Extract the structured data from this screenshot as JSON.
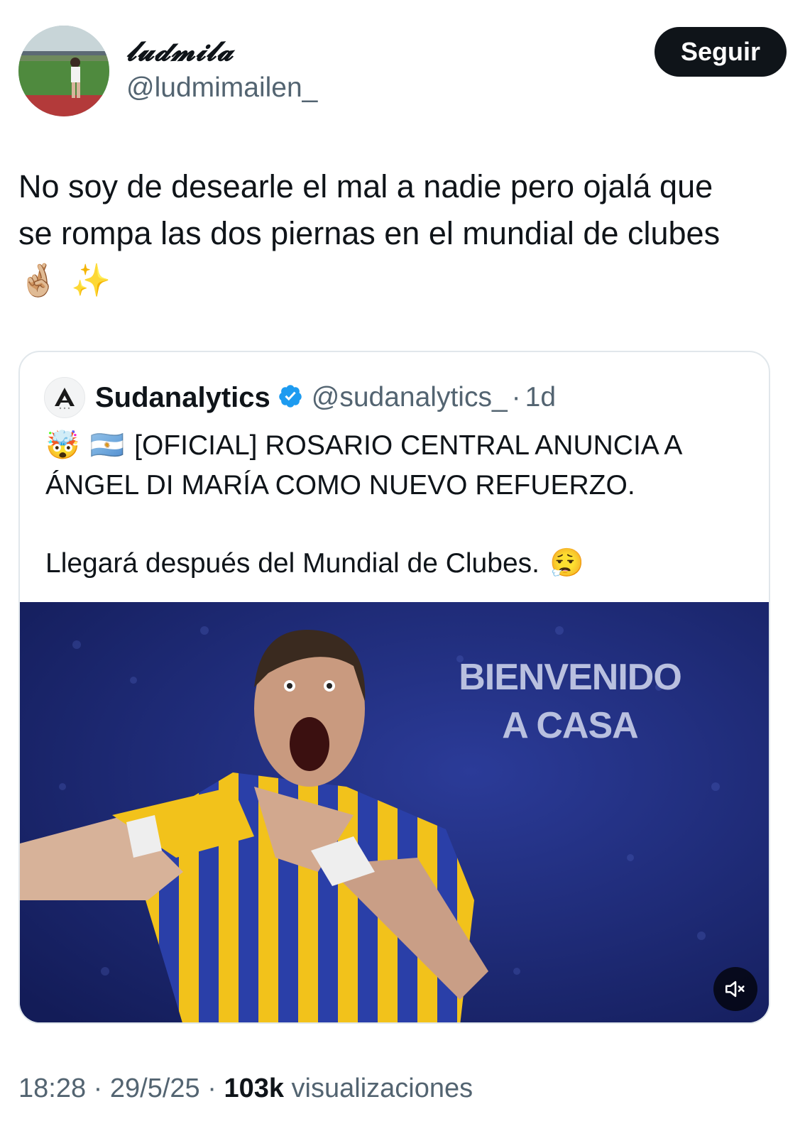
{
  "author": {
    "display_name": "𝓵𝓾𝓭𝓶𝓲𝓵𝓪",
    "handle": "@ludmimailen_",
    "follow_label": "Seguir"
  },
  "tweet": {
    "text_line1": "No soy de desearle el mal a nadie pero ojalá que",
    "text_line2": "se rompa las dos piernas en el mundial de clubes",
    "emojis": [
      "🤞🏼",
      "✨"
    ]
  },
  "quoted": {
    "name": "Sudanalytics",
    "handle": "@sudanalytics_",
    "dot": "·",
    "time": "1d",
    "verified_icon": "verified-badge-icon",
    "emoji_lead": "🤯",
    "flag": "🇦🇷",
    "line1": "[OFICIAL] ROSARIO CENTRAL ANUNCIA A",
    "line2": "ÁNGEL DI MARÍA COMO NUEVO REFUERZO.",
    "line3": "Llegará después del Mundial de Clubes.",
    "emoji_trail": "😮‍💨",
    "media": {
      "overlay_line1": "BIENVENIDO",
      "overlay_line2": "A CASA",
      "mute_icon": "volume-muted-icon"
    }
  },
  "meta": {
    "time": "18:28",
    "sep1": " · ",
    "date": "29/5/25",
    "sep2": " · ",
    "views_count": "103k",
    "views_label": " visualizaciones"
  },
  "colors": {
    "text": "#0f1419",
    "secondary": "#536471",
    "verified": "#1d9bf0",
    "button": "#0f1419",
    "media_bg": "#1c2870",
    "jersey_yellow": "#f2c21b"
  }
}
